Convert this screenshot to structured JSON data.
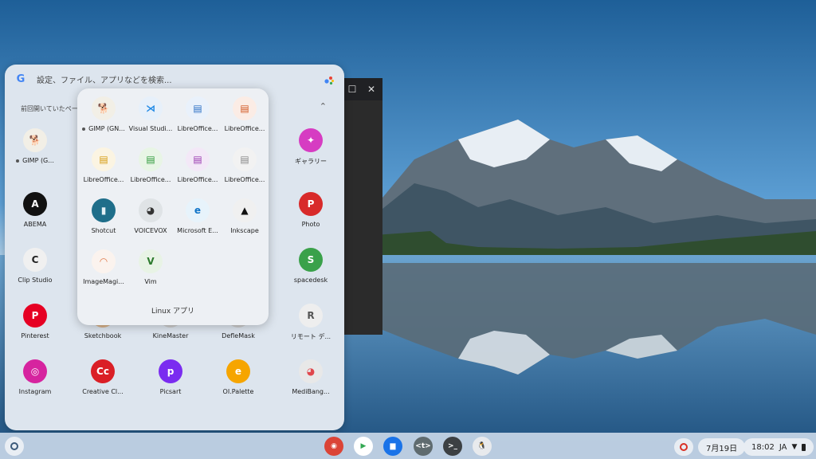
{
  "search": {
    "placeholder": "設定、ファイル、アプリなどを検索..."
  },
  "recent": {
    "label": "前回開いていたペー"
  },
  "launcher_apps": [
    {
      "label": "GIMP (G...",
      "color": "#f2efe6",
      "glyph": "🐕",
      "glyph_color": "#555",
      "running": true
    },
    {
      "label": "ギャラリー",
      "color": "#d63cc2",
      "glyph": "✦",
      "glyph_color": "#fff"
    },
    {
      "label": "ABEMA",
      "color": "#111111",
      "glyph": "A",
      "glyph_color": "#fff"
    },
    {
      "label": "Photo",
      "color": "#d82a2a",
      "glyph": "P",
      "glyph_color": "#fff"
    },
    {
      "label": "Clip Studio",
      "color": "#f0f0f0",
      "glyph": "C",
      "glyph_color": "#222"
    },
    {
      "label": "spacedesk",
      "color": "#3aa14a",
      "glyph": "S",
      "glyph_color": "#fff"
    },
    {
      "label": "Pinterest",
      "color": "#e60023",
      "glyph": "P",
      "glyph_color": "#fff"
    },
    {
      "label": "Sketchbook",
      "color": "#d9b38a",
      "glyph": "S",
      "glyph_color": "#fff"
    },
    {
      "label": "KineMaster",
      "color": "#ccc",
      "glyph": "K",
      "glyph_color": "#fff"
    },
    {
      "label": "DefleMask",
      "color": "#ccc",
      "glyph": "D",
      "glyph_color": "#fff"
    },
    {
      "label": "リモート デ...",
      "color": "#eeeeee",
      "glyph": "R",
      "glyph_color": "#555"
    },
    {
      "label": "Instagram",
      "color": "#d6249f",
      "glyph": "◎",
      "glyph_color": "#fff"
    },
    {
      "label": "Creative Cl...",
      "color": "#da1f26",
      "glyph": "Cc",
      "glyph_color": "#fff"
    },
    {
      "label": "Picsart",
      "color": "#7a2cf0",
      "glyph": "p",
      "glyph_color": "#fff"
    },
    {
      "label": "OI.Palette",
      "color": "#f6a500",
      "glyph": "e",
      "glyph_color": "#fff"
    },
    {
      "label": "MediBang...",
      "color": "#e8e8e8",
      "glyph": "◕",
      "glyph_color": "#e0474c"
    }
  ],
  "folder": {
    "title": "Linux アプリ",
    "apps": [
      {
        "label": "GIMP (GN...",
        "color": "#f2efe6",
        "glyph": "🐕",
        "glyph_color": "#555",
        "running": true
      },
      {
        "label": "Visual Studi...",
        "color": "#e7f0fa",
        "glyph": "⋊",
        "glyph_color": "#1e88e5"
      },
      {
        "label": "LibreOffice...",
        "color": "#e9f1fb",
        "glyph": "▤",
        "glyph_color": "#2a6fc4"
      },
      {
        "label": "LibreOffice...",
        "color": "#fbece5",
        "glyph": "▤",
        "glyph_color": "#d0551f"
      },
      {
        "label": "LibreOffice...",
        "color": "#fbf4e2",
        "glyph": "▤",
        "glyph_color": "#d59a0f"
      },
      {
        "label": "LibreOffice...",
        "color": "#e8f5e5",
        "glyph": "▤",
        "glyph_color": "#2f9a3b"
      },
      {
        "label": "LibreOffice...",
        "color": "#f3e8f7",
        "glyph": "▤",
        "glyph_color": "#9a3ab0"
      },
      {
        "label": "LibreOffice...",
        "color": "#f2f2f2",
        "glyph": "▤",
        "glyph_color": "#888"
      },
      {
        "label": "Shotcut",
        "color": "#1f6e8a",
        "glyph": "▮",
        "glyph_color": "#e3f0f5"
      },
      {
        "label": "VOICEVOX",
        "color": "#dfe3e6",
        "glyph": "◕",
        "glyph_color": "#333"
      },
      {
        "label": "Microsoft E...",
        "color": "#e7f3fb",
        "glyph": "e",
        "glyph_color": "#0f74c8"
      },
      {
        "label": "Inkscape",
        "color": "#f0f0f0",
        "glyph": "▲",
        "glyph_color": "#111"
      },
      {
        "label": "ImageMagi...",
        "color": "#fbf3ee",
        "glyph": "◠",
        "glyph_color": "#e07a4a"
      },
      {
        "label": "Vim",
        "color": "#e8f3e5",
        "glyph": "V",
        "glyph_color": "#2c7a2c"
      }
    ]
  },
  "window": {
    "maximize": "☐",
    "close": "✕"
  },
  "shelf": {
    "apps": [
      {
        "name": "chrome-icon",
        "color": "#db4437",
        "glyph": "◉"
      },
      {
        "name": "play-store-icon",
        "color": "#ffffff",
        "glyph": "▶"
      },
      {
        "name": "files-icon",
        "color": "#1a73e8",
        "glyph": "▆"
      },
      {
        "name": "text-icon",
        "color": "#5f6b6f",
        "glyph": "<t>"
      },
      {
        "name": "terminal-icon",
        "color": "#3c4043",
        "glyph": ">_"
      },
      {
        "name": "penguin-icon",
        "color": "#e8eaed",
        "glyph": "🐧"
      }
    ],
    "date": "7月19日",
    "time": "18:02",
    "ime": "JA"
  }
}
